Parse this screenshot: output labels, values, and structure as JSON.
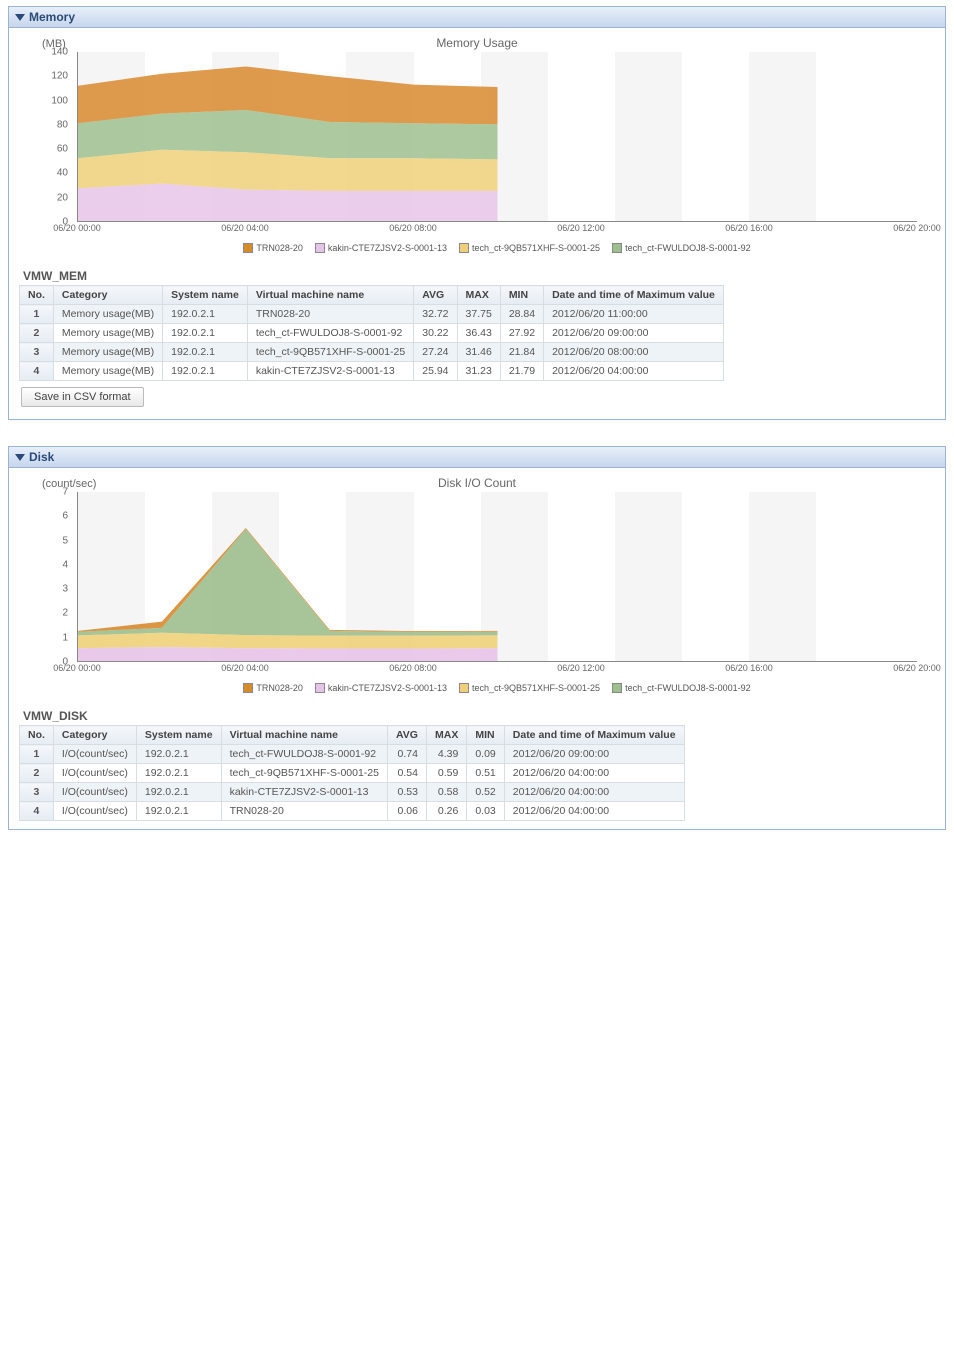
{
  "panels": {
    "memory": {
      "header": "Memory",
      "chart_title": "Memory Usage",
      "y_unit": "(MB)"
    },
    "disk": {
      "header": "Disk",
      "chart_title": "Disk I/O Count",
      "y_unit": "(count/sec)"
    }
  },
  "legend": {
    "s0": "TRN028-20",
    "s1": "kakin-CTE7ZJSV2-S-0001-13",
    "s2": "tech_ct-9QB571XHF-S-0001-25",
    "s3": "tech_ct-FWULDOJ8-S-0001-92"
  },
  "x_ticks": {
    "t0": "06/20 00:00",
    "t1": "06/20 04:00",
    "t2": "06/20 08:00",
    "t3": "06/20 12:00",
    "t4": "06/20 16:00",
    "t5": "06/20 20:00"
  },
  "mem_tbl": {
    "title": "VMW_MEM",
    "h_no": "No.",
    "h_cat": "Category",
    "h_sys": "System name",
    "h_vm": "Virtual machine name",
    "h_avg": "AVG",
    "h_max": "MAX",
    "h_min": "MIN",
    "h_dt": "Date and time of Maximum value",
    "r1": {
      "no": "1",
      "cat": "Memory usage(MB)",
      "sys": "192.0.2.1",
      "vm": "TRN028-20",
      "avg": "32.72",
      "max": "37.75",
      "min": "28.84",
      "dt": "2012/06/20 11:00:00"
    },
    "r2": {
      "no": "2",
      "cat": "Memory usage(MB)",
      "sys": "192.0.2.1",
      "vm": "tech_ct-FWULDOJ8-S-0001-92",
      "avg": "30.22",
      "max": "36.43",
      "min": "27.92",
      "dt": "2012/06/20 09:00:00"
    },
    "r3": {
      "no": "3",
      "cat": "Memory usage(MB)",
      "sys": "192.0.2.1",
      "vm": "tech_ct-9QB571XHF-S-0001-25",
      "avg": "27.24",
      "max": "31.46",
      "min": "21.84",
      "dt": "2012/06/20 08:00:00"
    },
    "r4": {
      "no": "4",
      "cat": "Memory usage(MB)",
      "sys": "192.0.2.1",
      "vm": "kakin-CTE7ZJSV2-S-0001-13",
      "avg": "25.94",
      "max": "31.23",
      "min": "21.79",
      "dt": "2012/06/20 04:00:00"
    }
  },
  "disk_tbl": {
    "title": "VMW_DISK",
    "h_no": "No.",
    "h_cat": "Category",
    "h_sys": "System name",
    "h_vm": "Virtual machine name",
    "h_avg": "AVG",
    "h_max": "MAX",
    "h_min": "MIN",
    "h_dt": "Date and time of Maximum value",
    "r1": {
      "no": "1",
      "cat": "I/O(count/sec)",
      "sys": "192.0.2.1",
      "vm": "tech_ct-FWULDOJ8-S-0001-92",
      "avg": "0.74",
      "max": "4.39",
      "min": "0.09",
      "dt": "2012/06/20 09:00:00"
    },
    "r2": {
      "no": "2",
      "cat": "I/O(count/sec)",
      "sys": "192.0.2.1",
      "vm": "tech_ct-9QB571XHF-S-0001-25",
      "avg": "0.54",
      "max": "0.59",
      "min": "0.51",
      "dt": "2012/06/20 04:00:00"
    },
    "r3": {
      "no": "3",
      "cat": "I/O(count/sec)",
      "sys": "192.0.2.1",
      "vm": "kakin-CTE7ZJSV2-S-0001-13",
      "avg": "0.53",
      "max": "0.58",
      "min": "0.52",
      "dt": "2012/06/20 04:00:00"
    },
    "r4": {
      "no": "4",
      "cat": "I/O(count/sec)",
      "sys": "192.0.2.1",
      "vm": "TRN028-20",
      "avg": "0.06",
      "max": "0.26",
      "min": "0.03",
      "dt": "2012/06/20 04:00:00"
    }
  },
  "buttons": {
    "save": "Save in CSV format"
  },
  "colors": {
    "s0": "#d88a2e",
    "s1": "#e7c4e9",
    "s2": "#f0d17a",
    "s3": "#9dbf8e"
  },
  "chart_data": [
    {
      "type": "area",
      "title": "Memory Usage",
      "ylabel": "(MB)",
      "xlabel": "",
      "ylim": [
        0,
        140
      ],
      "y_ticks": [
        0,
        20,
        40,
        60,
        80,
        100,
        120,
        140
      ],
      "categories": [
        "06/20 00:00",
        "06/20 04:00",
        "06/20 08:00",
        "06/20 12:00",
        "06/20 16:00",
        "06/20 20:00"
      ],
      "stacked": true,
      "series": [
        {
          "name": "kakin-CTE7ZJSV2-S-0001-13",
          "values": [
            27,
            31,
            26,
            25,
            25,
            25
          ]
        },
        {
          "name": "tech_ct-9QB571XHF-S-0001-25",
          "values": [
            25,
            28,
            31,
            27,
            27,
            26
          ]
        },
        {
          "name": "tech_ct-FWULDOJ8-S-0001-92",
          "values": [
            29,
            30,
            35,
            30,
            29,
            29
          ]
        },
        {
          "name": "TRN028-20",
          "values": [
            31,
            33,
            36,
            38,
            32,
            31
          ]
        }
      ],
      "cumulative_top": [
        [
          27,
          31,
          26,
          25,
          25,
          25
        ],
        [
          52,
          59,
          57,
          52,
          52,
          51
        ],
        [
          81,
          89,
          92,
          82,
          81,
          80
        ],
        [
          112,
          122,
          128,
          120,
          113,
          111
        ]
      ]
    },
    {
      "type": "area",
      "title": "Disk I/O Count",
      "ylabel": "(count/sec)",
      "xlabel": "",
      "ylim": [
        0,
        7
      ],
      "y_ticks": [
        0,
        1,
        2,
        3,
        4,
        5,
        6,
        7
      ],
      "categories": [
        "06/20 00:00",
        "06/20 04:00",
        "06/20 08:00",
        "06/20 12:00",
        "06/20 16:00",
        "06/20 20:00"
      ],
      "stacked": true,
      "series": [
        {
          "name": "kakin-CTE7ZJSV2-S-0001-13",
          "values": [
            0.53,
            0.58,
            0.53,
            0.52,
            0.52,
            0.53
          ]
        },
        {
          "name": "tech_ct-9QB571XHF-S-0001-25",
          "values": [
            0.53,
            0.59,
            0.54,
            0.53,
            0.53,
            0.53
          ]
        },
        {
          "name": "tech_ct-FWULDOJ8-S-0001-92",
          "values": [
            0.15,
            0.2,
            4.39,
            0.2,
            0.15,
            0.15
          ]
        },
        {
          "name": "TRN028-20",
          "values": [
            0.04,
            0.26,
            0.05,
            0.04,
            0.04,
            0.04
          ]
        }
      ],
      "cumulative_top": [
        [
          0.53,
          0.58,
          0.53,
          0.52,
          0.52,
          0.53
        ],
        [
          1.06,
          1.17,
          1.07,
          1.05,
          1.05,
          1.06
        ],
        [
          1.21,
          1.37,
          5.46,
          1.25,
          1.2,
          1.21
        ],
        [
          1.25,
          1.63,
          5.51,
          1.29,
          1.24,
          1.25
        ]
      ]
    }
  ]
}
